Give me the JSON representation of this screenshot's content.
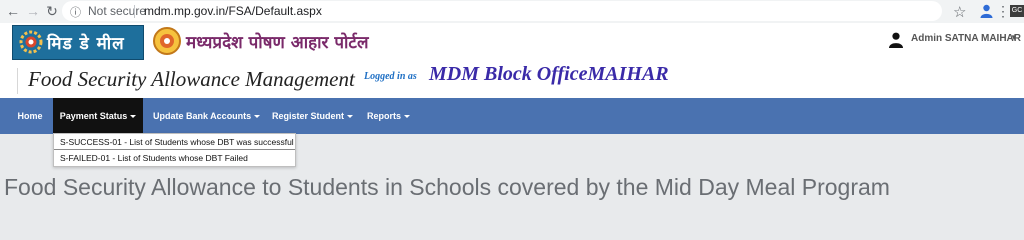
{
  "browser": {
    "not_secure": "Not secure",
    "url": "mdm.mp.gov.in/FSA/Default.aspx",
    "ext_label": "GC"
  },
  "header": {
    "mdm_logo_text": "मिड डे मील",
    "portal_title": "मध्यप्रदेश पोषण आहार पोर्टल",
    "admin_label": "Admin SATNA MAIHAR"
  },
  "banner": {
    "app_title": "Food Security Allowance Management",
    "logged_in_as": "Logged in as",
    "office_name": "MDM Block OfficeMAIHAR"
  },
  "nav": {
    "home": "Home",
    "payment_status": "Payment Status",
    "update_bank_accounts": "Update Bank Accounts",
    "register_student": "Register Student",
    "reports": "Reports"
  },
  "payment_menu": {
    "success": "S-SUCCESS-01 - List of Students whose DBT was successful",
    "failed": "S-FAILED-01 - List of Students whose DBT Failed"
  },
  "main": {
    "heading": "Food Security Allowance to Students in Schools covered by the Mid Day Meal Program"
  },
  "colors": {
    "navbar": "#4a72b0",
    "nav_active": "#111111",
    "office_name": "#3a2aa8",
    "logged_in": "#1e6fc4"
  }
}
